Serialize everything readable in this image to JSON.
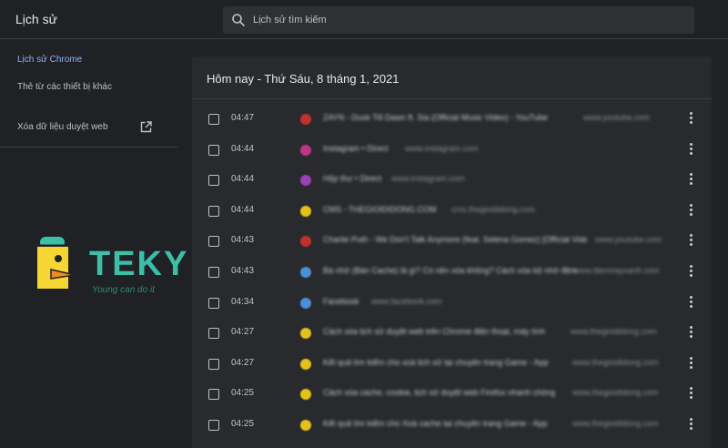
{
  "header": {
    "title": "Lịch sử",
    "search_placeholder": "Lịch sử tìm kiếm"
  },
  "sidebar": {
    "items": [
      {
        "label": "Lịch sử Chrome",
        "active": true
      },
      {
        "label": "Thẻ từ các thiết bị khác",
        "active": false
      },
      {
        "label": "Xóa dữ liệu duyệt web",
        "active": false
      }
    ]
  },
  "watermark": {
    "brand": "TEKY",
    "tagline": "Young can do it"
  },
  "history": {
    "date_heading": "Hôm nay - Thứ Sáu, 8 tháng 1, 2021",
    "entries": [
      {
        "time": "04:47",
        "title": "ZAYN - Dusk Till Dawn ft. Sia (Official Music Video) - YouTube",
        "domain": "www.youtube.com",
        "favicon_color": "#c4302b"
      },
      {
        "time": "04:44",
        "title": "Instagram • Direct",
        "domain": "www.instagram.com",
        "favicon_color": "#c13584"
      },
      {
        "time": "04:44",
        "title": "Hộp thư • Direct",
        "domain": "www.instagram.com",
        "favicon_color": "#9b3fb5"
      },
      {
        "time": "04:44",
        "title": "CMS - THEGIOIDIDONG.COM",
        "domain": "cms.thegioididong.com",
        "favicon_color": "#e5c21a"
      },
      {
        "time": "04:43",
        "title": "Charlie Puth - We Don't Talk Anymore (feat. Selena Gomez) [Official Video]",
        "domain": "www.youtube.com",
        "favicon_color": "#c4302b"
      },
      {
        "time": "04:43",
        "title": "Bà nhớ (Bàn Cache) là gì? Có nên xóa không? Cách xóa bộ nhớ đệm",
        "domain": "www.dienmayxanh.com",
        "favicon_color": "#4a90d9"
      },
      {
        "time": "04:34",
        "title": "Facebook",
        "domain": "www.facebook.com",
        "favicon_color": "#4a90d9"
      },
      {
        "time": "04:27",
        "title": "Cách xóa lịch sử duyệt web trên Chrome điện thoại, máy tính",
        "domain": "www.thegioididong.com",
        "favicon_color": "#e5c21a"
      },
      {
        "time": "04:27",
        "title": "Kết quả tìm kiếm cho xoá lịch sử tại chuyên trang Game - App",
        "domain": "www.thegioididong.com",
        "favicon_color": "#e5c21a"
      },
      {
        "time": "04:25",
        "title": "Cách xóa cache, cookie, lịch sử duyệt web Firefox nhanh chóng",
        "domain": "www.thegioididong.com",
        "favicon_color": "#e5c21a"
      },
      {
        "time": "04:25",
        "title": "Kết quả tìm kiếm cho Xoá cache tại chuyên trang Game - App",
        "domain": "www.thegioididong.com",
        "favicon_color": "#e5c21a"
      }
    ]
  }
}
